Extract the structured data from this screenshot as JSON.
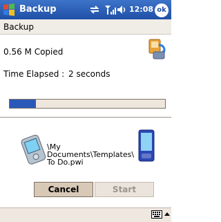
{
  "titlebar": {
    "title": "Backup",
    "time": "12:08",
    "ok_label": "ok"
  },
  "header": {
    "subtitle": "Backup"
  },
  "status": {
    "copied": "0.56 M Copied",
    "elapsed_label": "Time Elapsed :",
    "elapsed_value": "2 seconds"
  },
  "progress": {
    "fraction": 0.17
  },
  "file": {
    "path_lines": [
      "\\My",
      "Documents\\Templates\\",
      "To Do.pwi"
    ]
  },
  "buttons": {
    "cancel": "Cancel",
    "start": "Start"
  },
  "colors": {
    "titlebar": "#2b5fb8",
    "progress_fill": "#2a58b8"
  }
}
